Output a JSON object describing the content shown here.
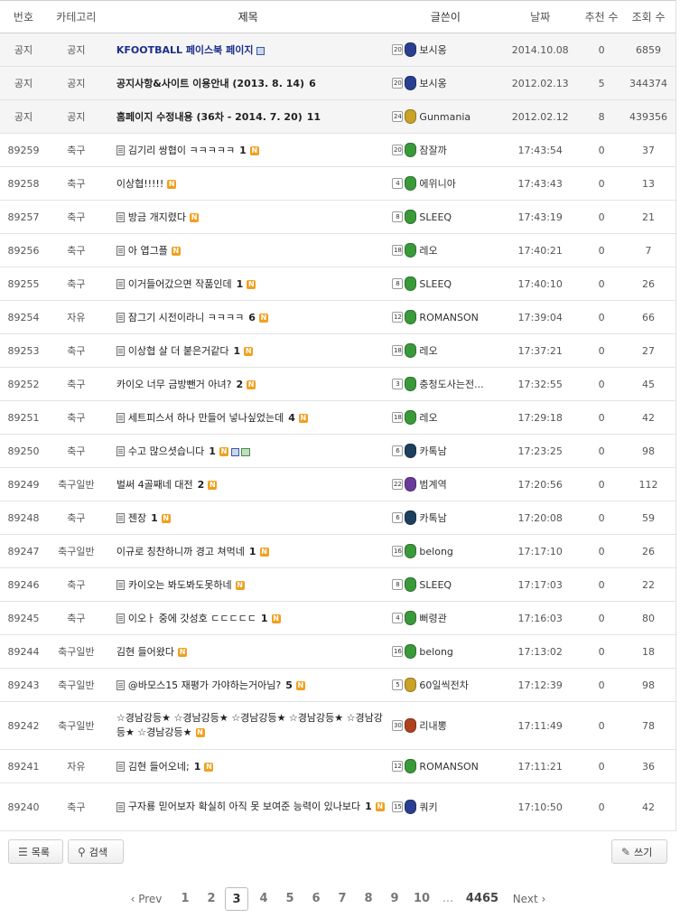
{
  "columns": {
    "no": "번호",
    "category": "카테고리",
    "title": "제목",
    "author": "글쓴이",
    "date": "날짜",
    "recommend": "추천 수",
    "views": "조회 수"
  },
  "notices": [
    {
      "no": "공지",
      "category": "공지",
      "title": "KFOOTBALL 페이스북 페이지",
      "comments": "",
      "level": "20",
      "emblem_color": "#2a3f8f",
      "author": "보시옹",
      "date": "2014.10.08",
      "recommend": "0",
      "views": "6859"
    },
    {
      "no": "공지",
      "category": "공지",
      "title": "공지사항&사이트 이용안내 (2013. 8. 14)",
      "comments": "6",
      "level": "20",
      "emblem_color": "#2a3f8f",
      "author": "보시옹",
      "date": "2012.02.13",
      "recommend": "5",
      "views": "344374"
    },
    {
      "no": "공지",
      "category": "공지",
      "title": "홈페이지 수정내용 (36차 - 2014. 7. 20)",
      "comments": "11",
      "level": "24",
      "emblem_color": "#c9a227",
      "author": "Gunmania",
      "date": "2012.02.12",
      "recommend": "8",
      "views": "439356"
    }
  ],
  "posts": [
    {
      "no": "89259",
      "category": "축구",
      "title": "김기리 쌍협이 ㅋㅋㅋㅋㅋ",
      "comments": "1",
      "level": "20",
      "emblem_color": "#3a9a3a",
      "author": "잠잘까",
      "date": "17:43:54",
      "recommend": "0",
      "views": "37"
    },
    {
      "no": "89258",
      "category": "축구",
      "title": "이상협!!!!!",
      "comments": "",
      "level": "4",
      "emblem_color": "#3a9a3a",
      "author": "에위니아",
      "date": "17:43:43",
      "recommend": "0",
      "views": "13"
    },
    {
      "no": "89257",
      "category": "축구",
      "title": "방금 개지렸다",
      "comments": "",
      "level": "8",
      "emblem_color": "#3a9a3a",
      "author": "SLEEQ",
      "date": "17:43:19",
      "recommend": "0",
      "views": "21"
    },
    {
      "no": "89256",
      "category": "축구",
      "title": "아 엽그플",
      "comments": "",
      "level": "18",
      "emblem_color": "#3a9a3a",
      "author": "레오",
      "date": "17:40:21",
      "recommend": "0",
      "views": "7"
    },
    {
      "no": "89255",
      "category": "축구",
      "title": "이거들어갔으면 작품인데",
      "comments": "1",
      "level": "8",
      "emblem_color": "#3a9a3a",
      "author": "SLEEQ",
      "date": "17:40:10",
      "recommend": "0",
      "views": "26"
    },
    {
      "no": "89254",
      "category": "자유",
      "title": "잠그기 시전이라니 ㅋㅋㅋㅋ",
      "comments": "6",
      "level": "12",
      "emblem_color": "#3a9a3a",
      "author": "ROMANSON",
      "date": "17:39:04",
      "recommend": "0",
      "views": "66"
    },
    {
      "no": "89253",
      "category": "축구",
      "title": "이상협 살 더 붙은거같다",
      "comments": "1",
      "level": "18",
      "emblem_color": "#3a9a3a",
      "author": "레오",
      "date": "17:37:21",
      "recommend": "0",
      "views": "27"
    },
    {
      "no": "89252",
      "category": "축구",
      "title": "카이오 너무 금방뺀거 아녀?",
      "comments": "2",
      "level": "3",
      "emblem_color": "#3a9a3a",
      "author": "충청도사는전...",
      "date": "17:32:55",
      "recommend": "0",
      "views": "45"
    },
    {
      "no": "89251",
      "category": "축구",
      "title": "세트피스서 하나 만들어 넣나싶었는데",
      "comments": "4",
      "level": "18",
      "emblem_color": "#3a9a3a",
      "author": "레오",
      "date": "17:29:18",
      "recommend": "0",
      "views": "42"
    },
    {
      "no": "89250",
      "category": "축구",
      "title": "수고 많으셧습니다",
      "comments": "1",
      "level": "6",
      "emblem_color": "#1f3f5f",
      "author": "카톡남",
      "date": "17:23:25",
      "recommend": "0",
      "views": "98"
    },
    {
      "no": "89249",
      "category": "축구일반",
      "title": "벌써 4골째네 대전",
      "comments": "2",
      "level": "22",
      "emblem_color": "#6a3a9a",
      "author": "범계역",
      "date": "17:20:56",
      "recommend": "0",
      "views": "112"
    },
    {
      "no": "89248",
      "category": "축구",
      "title": "젠장",
      "comments": "1",
      "level": "6",
      "emblem_color": "#1f3f5f",
      "author": "카톡남",
      "date": "17:20:08",
      "recommend": "0",
      "views": "59"
    },
    {
      "no": "89247",
      "category": "축구일반",
      "title": "이규로 칭찬하니까 경고 쳐먹네",
      "comments": "1",
      "level": "16",
      "emblem_color": "#3a9a3a",
      "author": "belong",
      "date": "17:17:10",
      "recommend": "0",
      "views": "26"
    },
    {
      "no": "89246",
      "category": "축구",
      "title": "카이오는 봐도봐도못하네",
      "comments": "",
      "level": "8",
      "emblem_color": "#3a9a3a",
      "author": "SLEEQ",
      "date": "17:17:03",
      "recommend": "0",
      "views": "22"
    },
    {
      "no": "89245",
      "category": "축구",
      "title": "이오ㅏ 중에 갓성호 ㄷㄷㄷㄷㄷ",
      "comments": "1",
      "level": "4",
      "emblem_color": "#3a9a3a",
      "author": "뻐령관",
      "date": "17:16:03",
      "recommend": "0",
      "views": "80"
    },
    {
      "no": "89244",
      "category": "축구일반",
      "title": "김현 들어왔다",
      "comments": "",
      "level": "16",
      "emblem_color": "#3a9a3a",
      "author": "belong",
      "date": "17:13:02",
      "recommend": "0",
      "views": "18"
    },
    {
      "no": "89243",
      "category": "축구일반",
      "title": "@바모스15 재평가 가야하는거아님?",
      "comments": "5",
      "level": "5",
      "emblem_color": "#c9a227",
      "author": "60일씩전차",
      "date": "17:12:39",
      "recommend": "0",
      "views": "98"
    },
    {
      "no": "89242",
      "category": "축구일반",
      "title": "☆경남강등★ ☆경남강등★ ☆경남강등★ ☆경남강등★ ☆경남강등★ ☆경남강등★",
      "comments": "",
      "level": "30",
      "emblem_color": "#b0411e",
      "author": "리내뽕",
      "date": "17:11:49",
      "recommend": "0",
      "views": "78"
    },
    {
      "no": "89241",
      "category": "자유",
      "title": "김현 들어오네;",
      "comments": "1",
      "level": "12",
      "emblem_color": "#3a9a3a",
      "author": "ROMANSON",
      "date": "17:11:21",
      "recommend": "0",
      "views": "36"
    },
    {
      "no": "89240",
      "category": "축구",
      "title": "구자룡 믿어보자 확실히 아직 못 보여준 능력이 있나보다",
      "comments": "1",
      "level": "15",
      "emblem_color": "#2a3f8f",
      "author": "쿼키",
      "date": "17:10:50",
      "recommend": "0",
      "views": "42"
    }
  ],
  "buttons": {
    "list": "목록",
    "search": "검색",
    "write": "쓰기"
  },
  "pagination": {
    "prev": "‹ Prev",
    "pages": [
      "1",
      "2",
      "3",
      "4",
      "5",
      "6",
      "7",
      "8",
      "9",
      "10"
    ],
    "current": "3",
    "ellipsis": "...",
    "last": "4465",
    "next": "Next ›"
  }
}
